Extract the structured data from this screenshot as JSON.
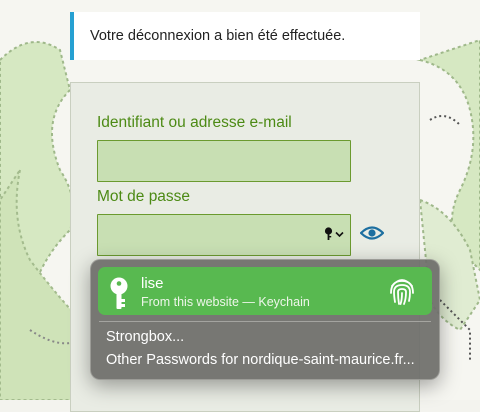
{
  "notice": {
    "text": "Votre déconnexion a bien été effectuée.",
    "accent_color": "#26a0d2"
  },
  "login_form": {
    "username_label": "Identifiant ou adresse e-mail",
    "username_value": "",
    "password_label": "Mot de passe",
    "password_value": "",
    "label_color": "#4c8a14",
    "field_color": "#c8dfb3",
    "show_password_icon": "eye-icon",
    "field_icon": "key-icon"
  },
  "autofill_popup": {
    "credential": {
      "username": "lise",
      "source": "From this website — Keychain",
      "icon": "key-icon",
      "auth_icon": "fingerprint-icon",
      "highlight_color": "#58b950"
    },
    "options": [
      {
        "label": "Strongbox..."
      },
      {
        "label": "Other Passwords for nordique-saint-maurice.fr..."
      }
    ]
  }
}
